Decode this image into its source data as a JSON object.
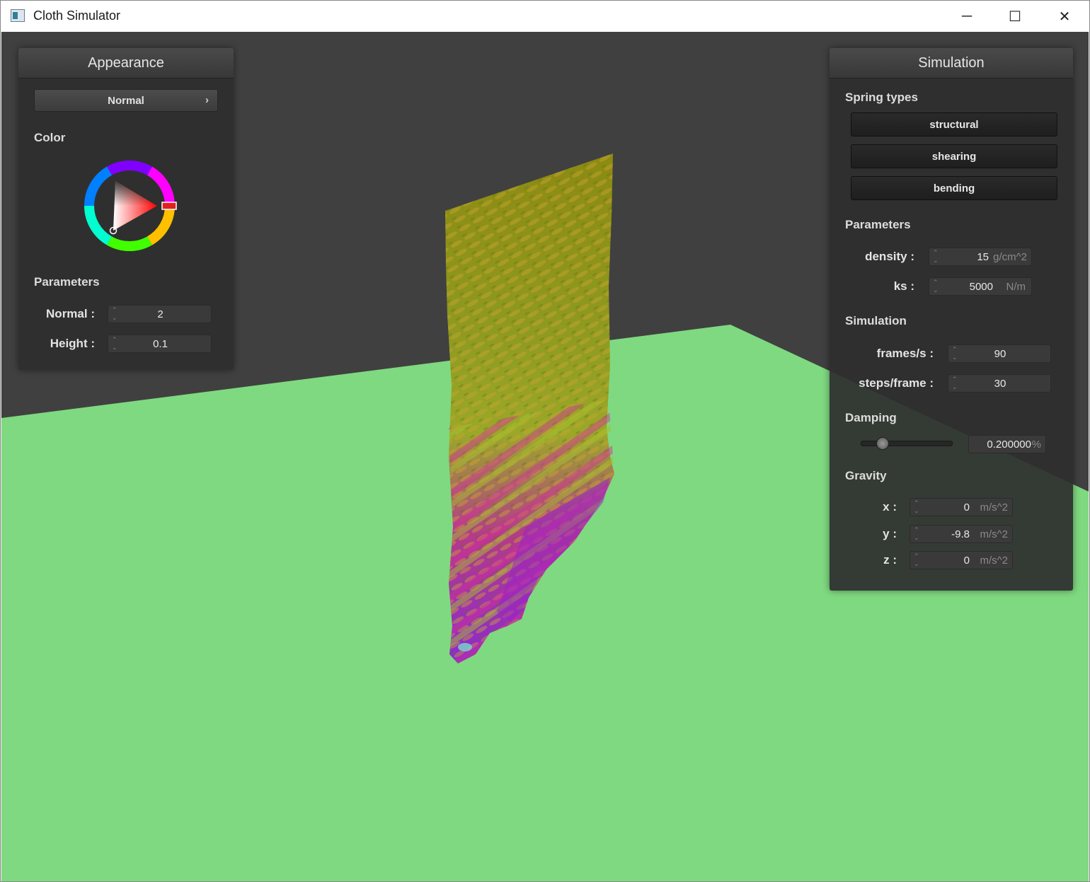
{
  "window": {
    "title": "Cloth Simulator",
    "controls": {
      "minimize": "─",
      "maximize": "☐",
      "close": "✕"
    }
  },
  "colors": {
    "background": "#404040",
    "floor": "#7fd980",
    "cloth_top": "#8a8a10",
    "cloth_bottom": "#a020c0",
    "selected_color": "#ff0000"
  },
  "appearance": {
    "title": "Appearance",
    "shader_selected": "Normal",
    "shader_chevron": "›",
    "color_label": "Color",
    "parameters_label": "Parameters",
    "normal_label": "Normal :",
    "normal_value": "2",
    "height_label": "Height :",
    "height_value": "0.1"
  },
  "simulation": {
    "title": "Simulation",
    "spring_types_label": "Spring types",
    "springs": [
      "structural",
      "shearing",
      "bending"
    ],
    "parameters_label": "Parameters",
    "density_label": "density :",
    "density_value": "15",
    "density_unit": "g/cm^2",
    "ks_label": "ks :",
    "ks_value": "5000",
    "ks_unit": "N/m",
    "simulation_label": "Simulation",
    "fps_label": "frames/s :",
    "fps_value": "90",
    "steps_label": "steps/frame :",
    "steps_value": "30",
    "damping_label": "Damping",
    "damping_value": "0.200000",
    "damping_unit": "%",
    "damping_fraction": 0.2,
    "gravity_label": "Gravity",
    "gx_label": "x :",
    "gx_value": "0",
    "gy_label": "y :",
    "gy_value": "-9.8",
    "gz_label": "z :",
    "gz_value": "0",
    "gravity_unit": "m/s^2"
  },
  "icons": {
    "spin_up": "⌃",
    "spin_down": "⌄"
  }
}
